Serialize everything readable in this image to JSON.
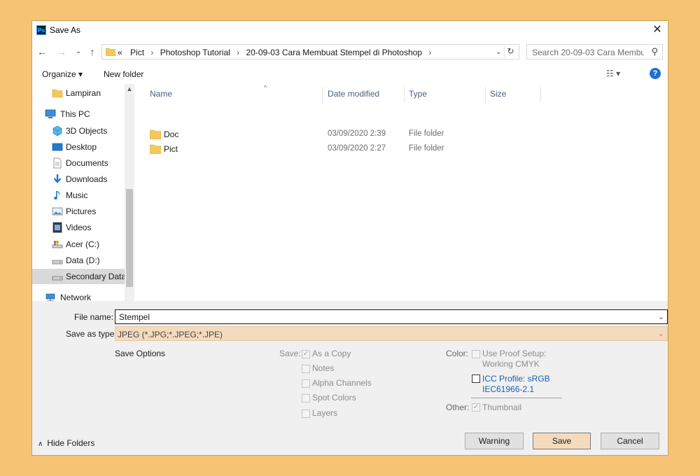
{
  "window": {
    "title": "Save As",
    "app_icon": "Ps",
    "close_label": "✕"
  },
  "address": {
    "prefix": "«",
    "crumbs": [
      "Pict",
      "Photoshop Tutorial",
      "20-09-03 Cara Membuat Stempel di Photoshop"
    ],
    "sep": "›"
  },
  "search": {
    "placeholder": "Search 20-09-03 Cara Membu..."
  },
  "toolbar": {
    "organize_label": "Organize ▾",
    "new_folder_label": "New folder",
    "help_label": "?"
  },
  "nav": {
    "items": [
      {
        "label": "Lampiran",
        "icon": "folder-icon"
      },
      {
        "label": "This PC",
        "icon": "pc-icon"
      },
      {
        "label": "3D Objects",
        "icon": "3d-objects-icon"
      },
      {
        "label": "Desktop",
        "icon": "desktop-icon"
      },
      {
        "label": "Documents",
        "icon": "documents-icon"
      },
      {
        "label": "Downloads",
        "icon": "downloads-icon"
      },
      {
        "label": "Music",
        "icon": "music-icon"
      },
      {
        "label": "Pictures",
        "icon": "pictures-icon"
      },
      {
        "label": "Videos",
        "icon": "videos-icon"
      },
      {
        "label": "Acer (C:)",
        "icon": "drive-c-icon"
      },
      {
        "label": "Data  (D:)",
        "icon": "drive-icon"
      },
      {
        "label": "Secondary Data",
        "icon": "drive-icon"
      },
      {
        "label": "Network",
        "icon": "network-icon"
      }
    ]
  },
  "columns": {
    "name": "Name",
    "date": "Date modified",
    "type": "Type",
    "size": "Size"
  },
  "files": [
    {
      "name": "Doc",
      "date": "03/09/2020 2:39",
      "type": "File folder"
    },
    {
      "name": "Pict",
      "date": "03/09/2020 2:27",
      "type": "File folder"
    }
  ],
  "form": {
    "file_name_label": "File name:",
    "file_name_value": "Stempel",
    "save_type_label": "Save as type:",
    "save_type_value": "JPEG (*.JPG;*.JPEG;*.JPE)"
  },
  "options": {
    "title": "Save Options",
    "save_label": "Save:",
    "save_items": [
      {
        "label": "As a Copy",
        "checked": true
      },
      {
        "label": "Notes",
        "checked": false
      },
      {
        "label": "Alpha Channels",
        "checked": false
      },
      {
        "label": "Spot Colors",
        "checked": false
      },
      {
        "label": "Layers",
        "checked": false
      }
    ],
    "color_label": "Color:",
    "proof_line1": "Use Proof Setup:",
    "proof_line2": "Working CMYK",
    "icc_line1": "ICC Profile:  sRGB",
    "icc_line2": "IEC61966-2.1",
    "other_label": "Other:",
    "thumbnail_label": "Thumbnail"
  },
  "buttons": {
    "warning": "Warning",
    "save": "Save",
    "cancel": "Cancel",
    "hide_folders": "Hide Folders"
  },
  "colors": {
    "background": "#f6c374",
    "accent": "#1f6fd1",
    "save_button": "#f5dbbd"
  }
}
